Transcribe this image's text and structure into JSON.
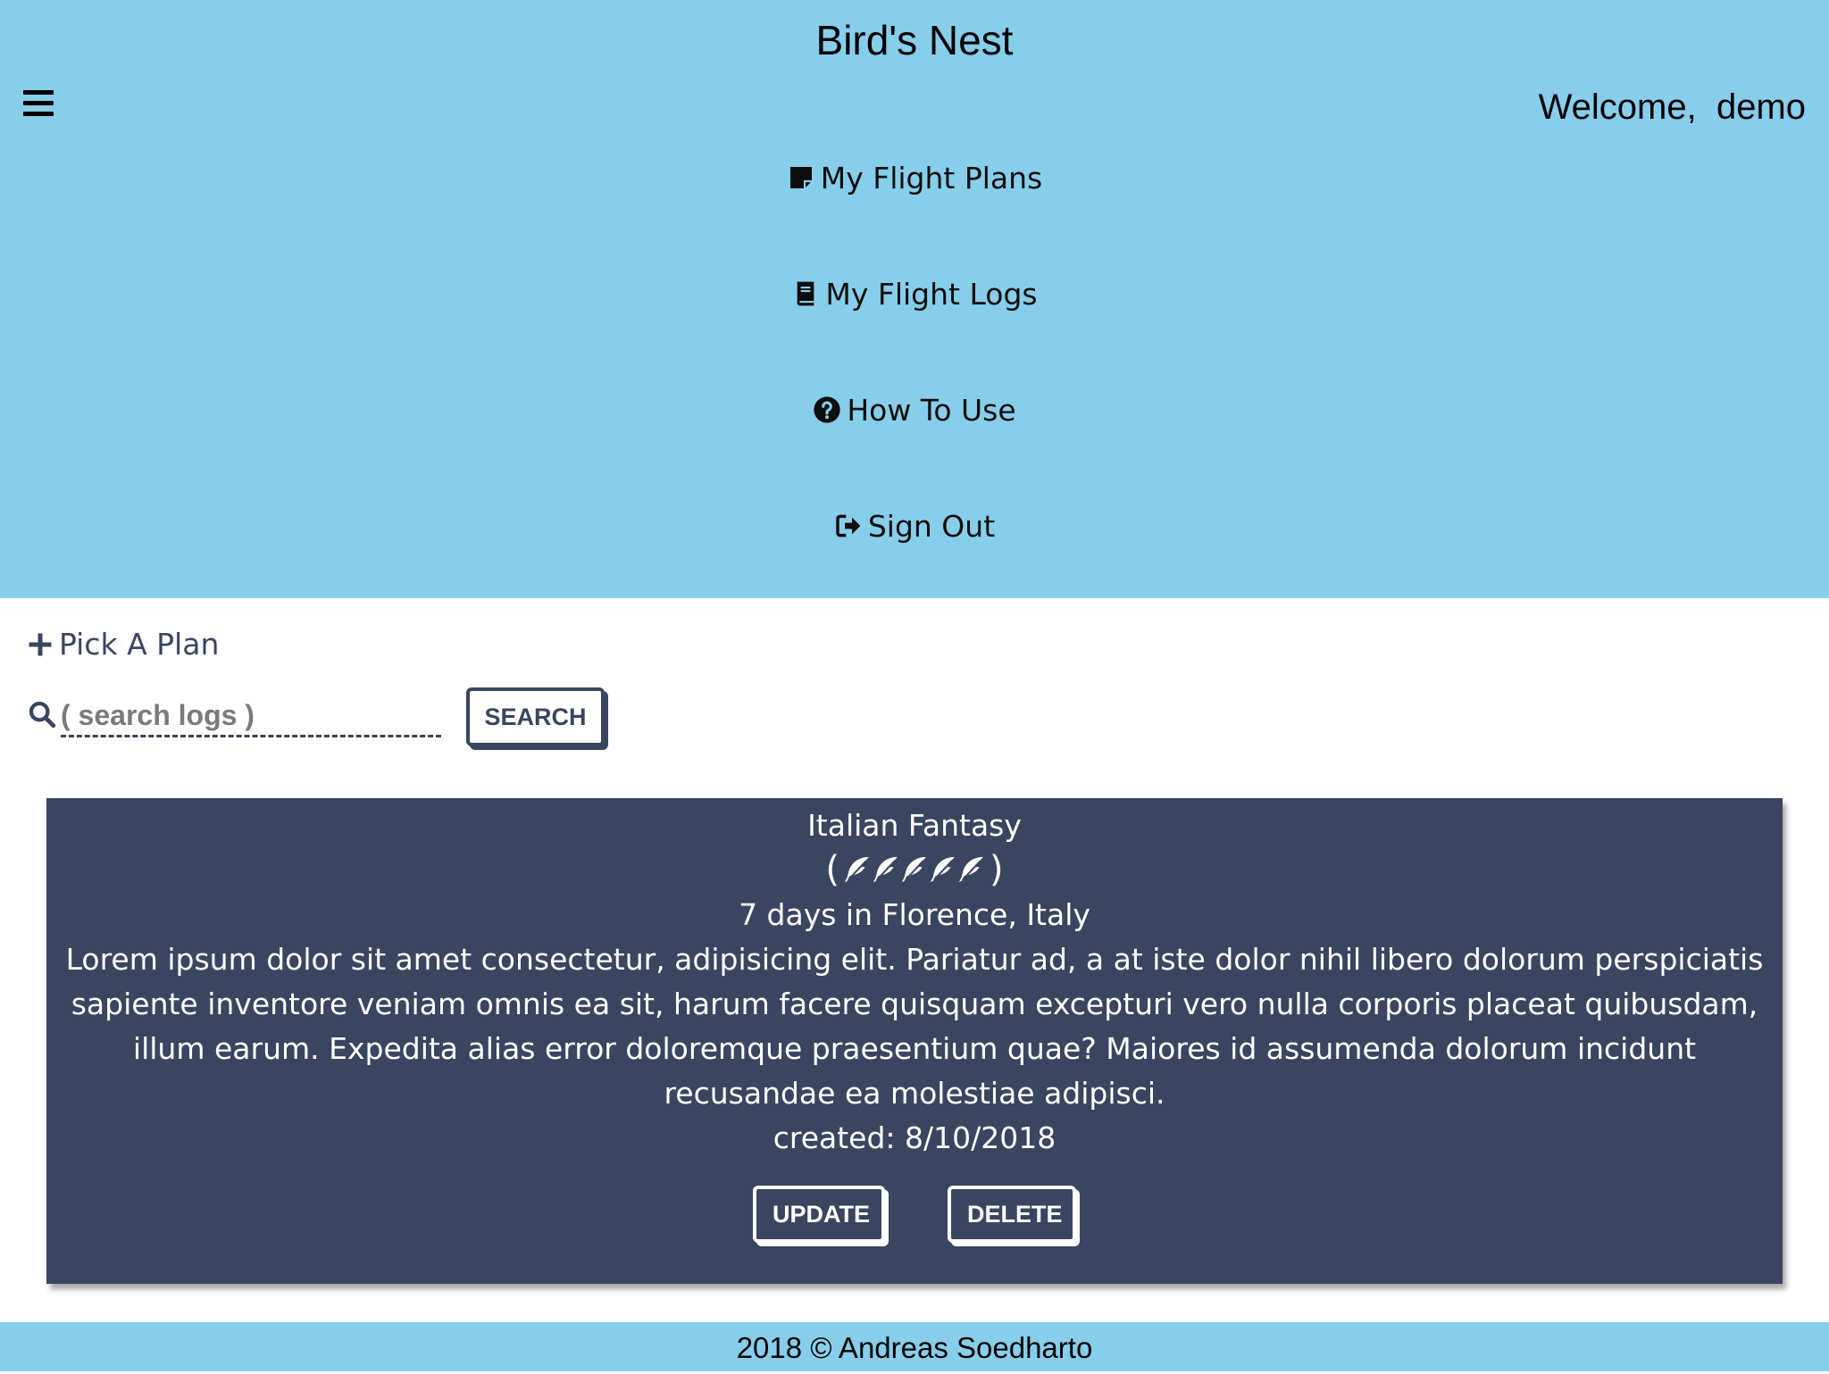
{
  "app": {
    "title": "Bird's Nest",
    "welcome": "Welcome,  demo"
  },
  "nav": {
    "items": [
      {
        "label": "My Flight Plans",
        "icon": "sticky-note-icon"
      },
      {
        "label": "My Flight Logs",
        "icon": "book-icon"
      },
      {
        "label": "How To Use",
        "icon": "question-circle-icon"
      },
      {
        "label": "Sign Out",
        "icon": "sign-out-icon"
      }
    ]
  },
  "tools": {
    "pick_plan_label": "Pick A Plan",
    "search_placeholder": "( search logs )",
    "search_button": "SEARCH"
  },
  "log": {
    "title": "Italian Fantasy",
    "rating_open": "(",
    "rating_close": ")",
    "rating": 5,
    "rating_max": 5,
    "rating_icon": "feather-icon",
    "duration": "7 days in Florence, Italy",
    "description": "Lorem ipsum dolor sit amet consectetur, adipisicing elit. Pariatur ad, a at iste dolor nihil libero dolorum perspiciatis sapiente inventore veniam omnis ea sit, harum facere quisquam excepturi vero nulla corporis placeat quibusdam, illum earum. Expedita alias error doloremque praesentium quae? Maiores id assumenda dolorum incidunt recusandae ea molestiae adipisci.",
    "created": "created: 8/10/2018",
    "update_button": "UPDATE",
    "delete_button": "DELETE"
  },
  "footer": {
    "text": "2018 © Andreas Soedharto"
  },
  "colors": {
    "header_bg": "#87ceeb",
    "card_bg": "#3a4560",
    "accent": "#3a4560"
  }
}
